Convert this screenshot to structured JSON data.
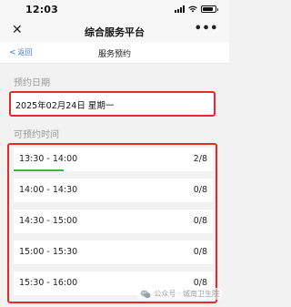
{
  "status_bar": {
    "time": "12:03",
    "signal_icon": "signal-bars-icon",
    "wifi_icon": "wifi-icon",
    "battery_icon": "battery-icon"
  },
  "nav_bar": {
    "close_glyph": "✕",
    "title": "综合服务平台",
    "more_glyph": "•••"
  },
  "sub_header": {
    "back_label": "返回",
    "title": "服务预约"
  },
  "booking_date": {
    "label": "预约日期",
    "value": "2025年02月24日 星期一"
  },
  "available_times": {
    "label": "可预约时间",
    "slots": [
      {
        "time": "13:30 - 14:00",
        "count": "2/8",
        "booked": 2,
        "capacity": 8
      },
      {
        "time": "14:00 - 14:30",
        "count": "0/8",
        "booked": 0,
        "capacity": 8
      },
      {
        "time": "14:30 - 15:00",
        "count": "0/8",
        "booked": 0,
        "capacity": 8
      },
      {
        "time": "15:00 - 15:30",
        "count": "0/8",
        "booked": 0,
        "capacity": 8
      },
      {
        "time": "15:30 - 16:00",
        "count": "0/8",
        "booked": 0,
        "capacity": 8
      }
    ]
  },
  "watermark": {
    "text": "公众号 · 城南卫生院",
    "icon": "wechat-icon"
  },
  "colors": {
    "highlight_border": "#e52a2a",
    "progress": "#3fb34f",
    "link": "#3a7bd5"
  }
}
